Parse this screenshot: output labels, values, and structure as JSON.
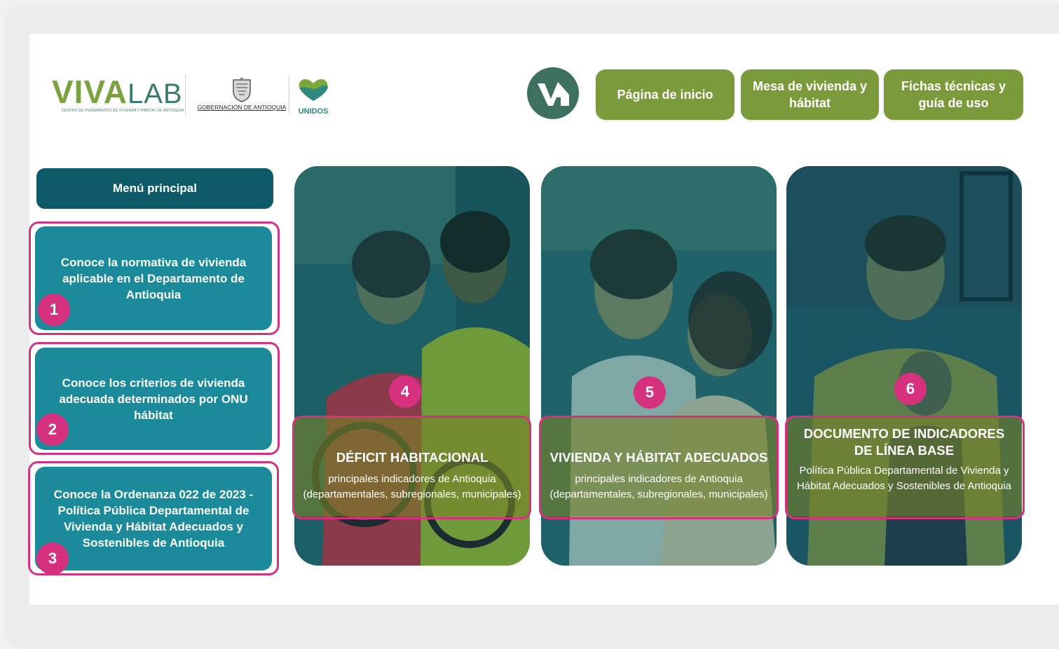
{
  "header": {
    "logo_vivalab_main": "VIVA",
    "logo_vivalab_lab": "LAB",
    "logo_vivalab_tag": "CENTRO DE PENSAMIENTO DE VIVIENDA Y HÁBITAT DE ANTIOQUIA",
    "logo_gobernacion": "GOBERNACIÓN DE ANTIOQUIA",
    "logo_unidos": "UNIDOS",
    "nav": [
      {
        "label": "Página de inicio"
      },
      {
        "label": "Mesa de vivienda y hábitat"
      },
      {
        "label": "Fichas técnicas y guía de uso"
      }
    ]
  },
  "menu": {
    "title": "Menú principal",
    "items": [
      {
        "label": "Conoce la normativa de vivienda aplicable en el Departamento de Antioquia",
        "number": "1"
      },
      {
        "label": "Conoce los criterios de vivienda adecuada determinados por ONU hábitat",
        "number": "2"
      },
      {
        "label": "Conoce la Ordenanza 022 de 2023 - Política Pública Departamental de Vivienda y Hábitat Adecuados y Sostenibles de Antioquia",
        "number": "3"
      }
    ]
  },
  "cards": [
    {
      "number": "4",
      "title": "DÉFICIT HABITACIONAL",
      "subtitle": "principales indicadores de Antioquia (departamentales, subregionales, municipales)"
    },
    {
      "number": "5",
      "title": "VIVIENDA Y HÁBITAT ADECUADOS",
      "subtitle": "principales indicadores de Antioquia (departamentales, subregionales, municipales)"
    },
    {
      "number": "6",
      "title": "DOCUMENTO DE INDICADORES DE LÍNEA BASE",
      "subtitle": "Política Pública Departamental de Vivienda y Hábitat Adecuados y Sostenibles de Antioquia"
    }
  ],
  "colors": {
    "primary_green": "#7a9a3c",
    "teal_dark": "#0f5a68",
    "teal_button": "#1b8a9a",
    "highlight_pink": "#d6317f",
    "home_circle": "#3d7060"
  },
  "icons": [
    "vivalab-home-icon",
    "gobernacion-seal-icon",
    "unidos-heart-icon"
  ]
}
